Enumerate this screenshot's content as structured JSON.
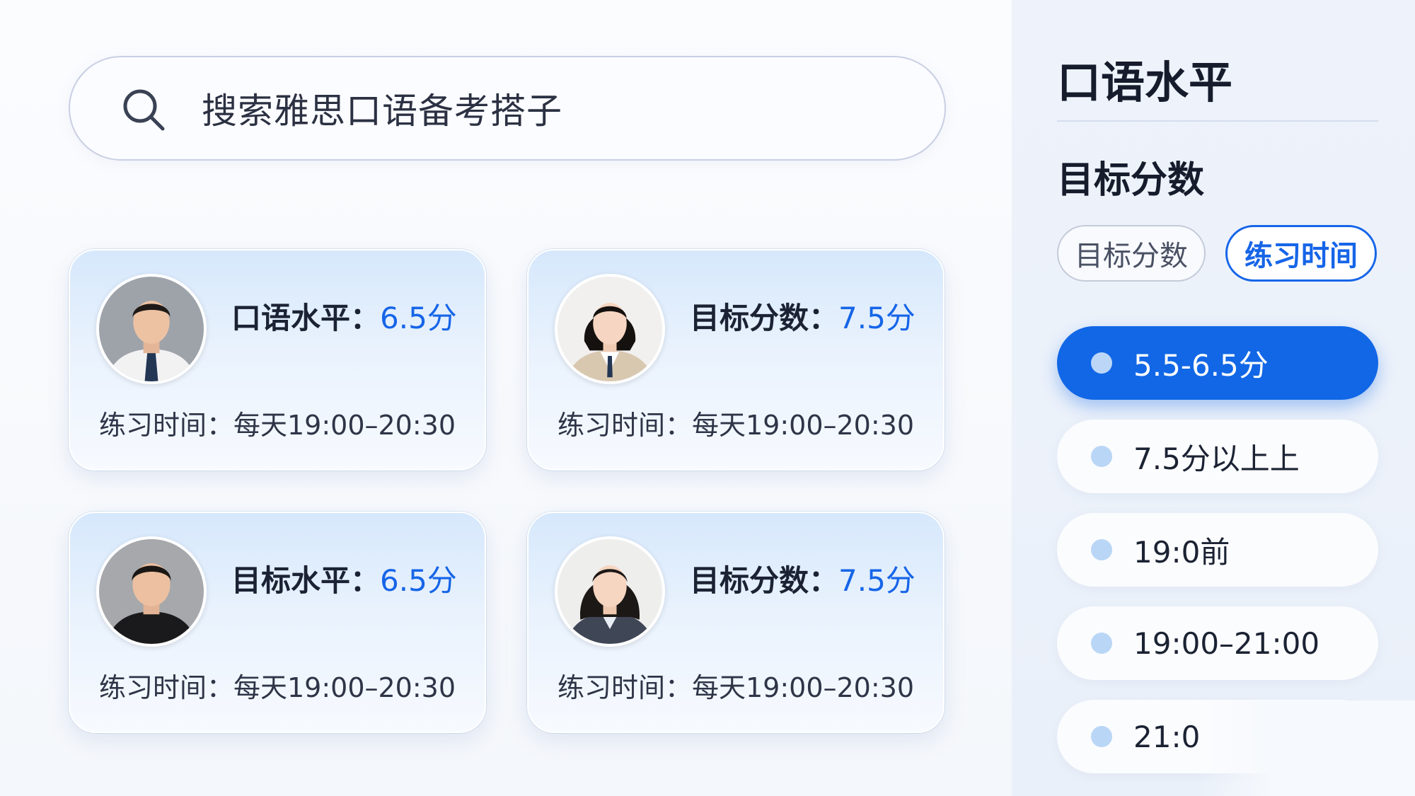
{
  "search": {
    "label": "搜索雅思口语备考搭子"
  },
  "cards": [
    {
      "label": "口语水平：",
      "score": "6.5分",
      "time": "练习时间：每天19:00–20:30"
    },
    {
      "label": "目标分数：",
      "score": "7.5分",
      "time": "练习时间：每天19:00–20:30"
    },
    {
      "label": "目标水平：",
      "score": "6.5分",
      "time": "练习时间：每天19:00–20:30"
    },
    {
      "label": "目标分数：",
      "score": "7.5分",
      "time": "练习时间：每天19:00–20:30"
    }
  ],
  "sidebar": {
    "title": "口语水平",
    "subtitle": "目标分数",
    "chips": [
      "目标分数",
      "练习时间"
    ],
    "options": [
      "5.5-6.5分",
      "7.5分以上上",
      "19:0前",
      "19:00–21:00",
      "21:0"
    ]
  },
  "colors": {
    "accent": "#1665e8",
    "selected_option": "#1167e6"
  }
}
